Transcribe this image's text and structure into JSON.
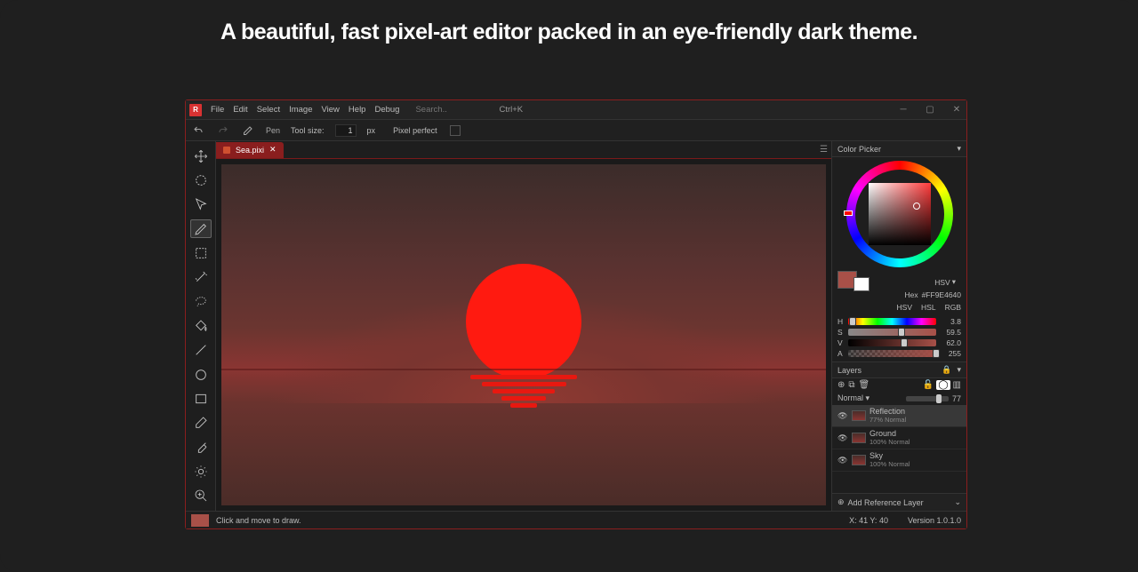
{
  "tagline": "A beautiful, fast pixel-art editor packed in an eye-friendly dark theme.",
  "menu": {
    "file": "File",
    "edit": "Edit",
    "select": "Select",
    "image": "Image",
    "view": "View",
    "help": "Help",
    "debug": "Debug"
  },
  "search": {
    "placeholder": "Search..",
    "shortcut": "Ctrl+K"
  },
  "toolbar": {
    "tool_name": "Pen",
    "tool_size_label": "Tool size:",
    "tool_size_value": "1",
    "tool_size_unit": "px",
    "pixel_perfect_label": "Pixel perfect"
  },
  "tab": {
    "filename": "Sea.pixi"
  },
  "color_picker": {
    "title": "Color Picker",
    "mode": "HSV",
    "hex_label": "Hex",
    "hex_value": "#FF9E4640",
    "modes": {
      "hsv": "HSV",
      "hsl": "HSL",
      "rgb": "RGB"
    },
    "sliders": {
      "h": {
        "label": "H",
        "value": "3.8"
      },
      "s": {
        "label": "S",
        "value": "59.5"
      },
      "v": {
        "label": "V",
        "value": "62.0"
      },
      "a": {
        "label": "A",
        "value": "255"
      }
    }
  },
  "layers": {
    "title": "Layers",
    "blend_mode": "Normal",
    "opacity": "77",
    "items": [
      {
        "name": "Reflection",
        "meta": "77%  Normal"
      },
      {
        "name": "Ground",
        "meta": "100%  Normal"
      },
      {
        "name": "Sky",
        "meta": "100%  Normal"
      }
    ],
    "add_reference": "Add Reference Layer"
  },
  "statusbar": {
    "hint": "Click and move to draw.",
    "coords": "X: 41 Y: 40",
    "version": "Version 1.0.1.0"
  }
}
